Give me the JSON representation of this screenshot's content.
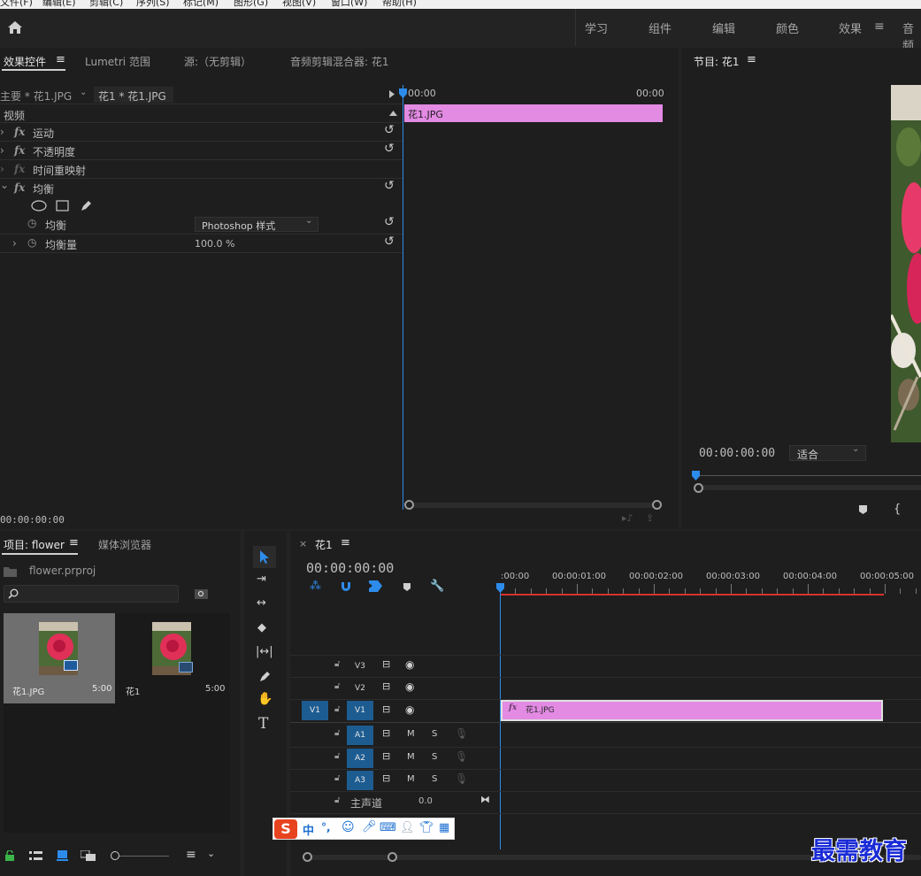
{
  "menu": [
    "文件(F)",
    "编辑(E)",
    "剪辑(C)",
    "序列(S)",
    "标记(M)",
    "图形(G)",
    "视图(V)",
    "窗口(W)",
    "帮助(H)"
  ],
  "workspaces": [
    "学习",
    "组件",
    "编辑",
    "颜色",
    "效果",
    "音频"
  ],
  "active_workspace": "效果",
  "top_left_tabs": {
    "effect_controls": "效果控件",
    "lumetri": "Lumetri 范围",
    "source": "源:（无剪辑）",
    "audio_mixer": "音频剪辑混合器: 花1"
  },
  "ec": {
    "master": "主要 * 花1.JPG",
    "sequence": "花1 * 花1.JPG",
    "time_start": "00:00",
    "time_end": "00:00",
    "clip": "花1.JPG",
    "video_header": "视频",
    "effects": [
      "运动",
      "不透明度",
      "时间重映射",
      "均衡"
    ],
    "param_balance": "均衡",
    "param_balance_value": "Photoshop 样式",
    "param_amount": "均衡量",
    "param_amount_value": "100.0 %",
    "timecode": "00:00:00:00"
  },
  "program": {
    "title": "节目: 花1",
    "timecode": "00:00:00:00",
    "fit": "适合"
  },
  "project": {
    "tab": "项目: flower",
    "media_browser": "媒体浏览器",
    "file": "flower.prproj",
    "items": [
      {
        "name": "花1.JPG",
        "duration": "5:00"
      },
      {
        "name": "花1",
        "duration": "5:00"
      }
    ]
  },
  "timeline": {
    "seq_name": "花1",
    "timecode": "00:00:00:00",
    "ruler": [
      ":00:00",
      "00:00:01:00",
      "00:00:02:00",
      "00:00:03:00",
      "00:00:04:00",
      "00:00:05:00"
    ],
    "video_tracks": [
      "V3",
      "V2",
      "V1"
    ],
    "source_patch": "V1",
    "audio_tracks": [
      "A1",
      "A2",
      "A3"
    ],
    "mute": "M",
    "solo": "S",
    "master": "主声道",
    "master_value": "0.0",
    "clip": "花1.JPG",
    "fx_badge": "fx"
  },
  "ime": {
    "lang": "中",
    "punct": "°,"
  },
  "watermark": "最需教育",
  "colors": {
    "accent": "#2d8ceb",
    "clip": "#e38ae3",
    "workarea": "#d9312b",
    "track_on": "#1d5c91"
  }
}
